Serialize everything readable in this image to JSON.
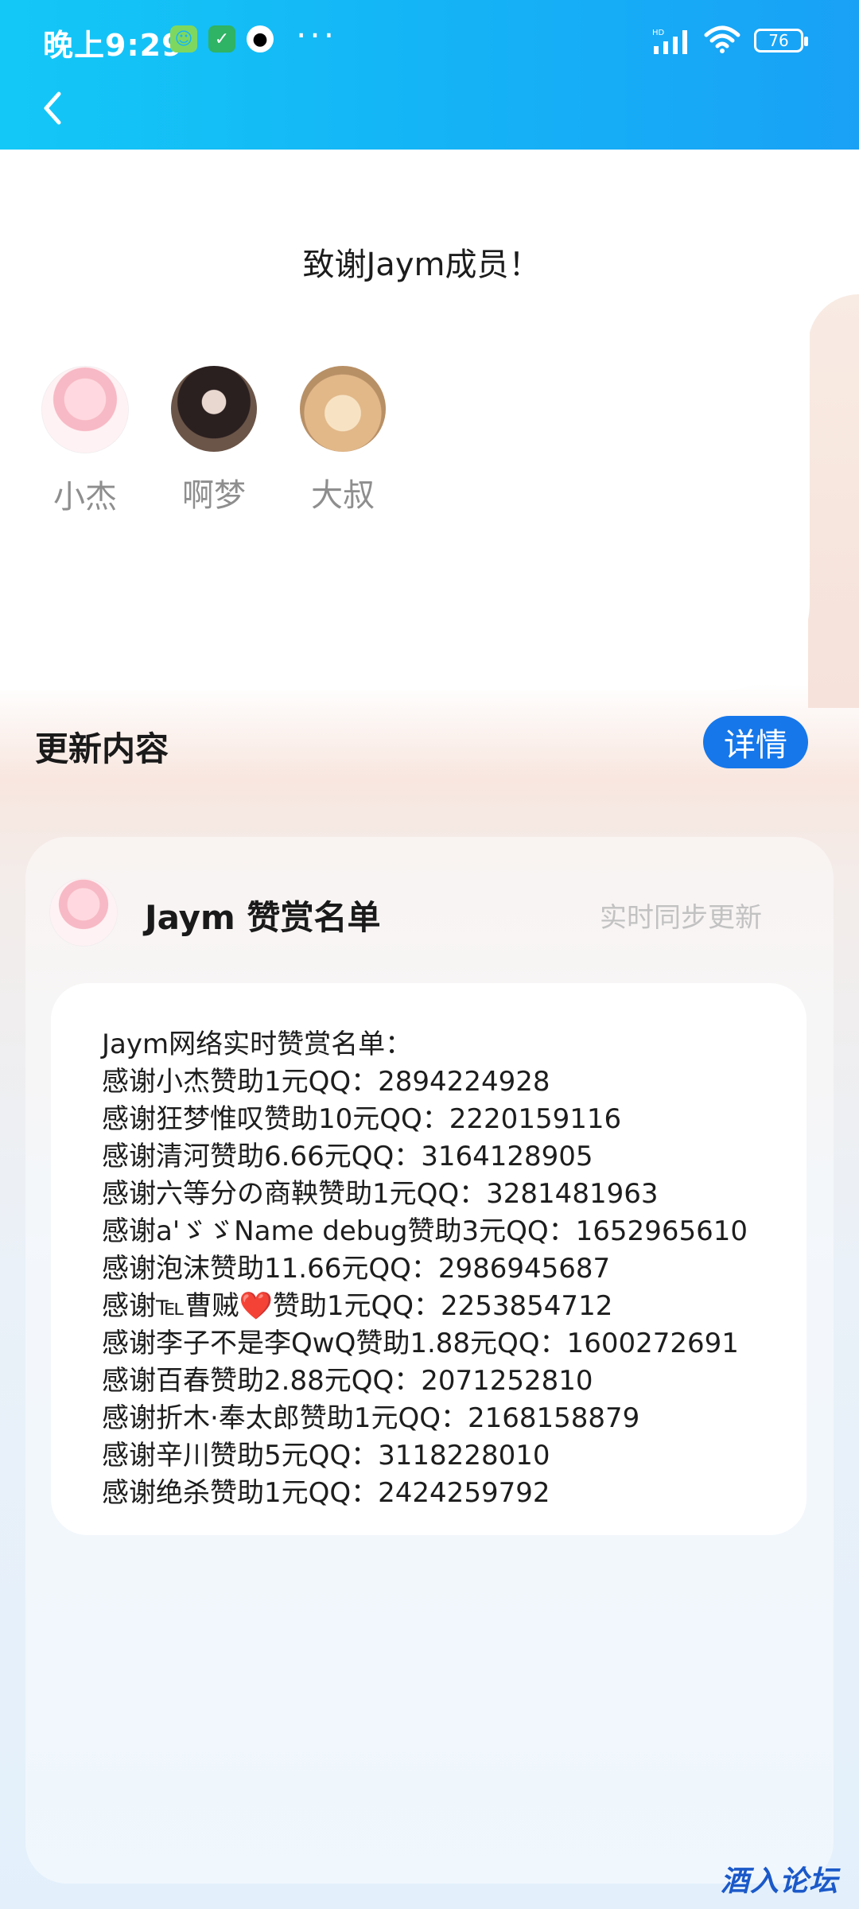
{
  "status_bar": {
    "time": "晚上9:29",
    "dots": "···",
    "battery": "76"
  },
  "thanks": {
    "title": "致谢Jaym成员！",
    "members": [
      {
        "name": "小杰",
        "avatar": "anime-girl-avatar"
      },
      {
        "name": "啊梦",
        "avatar": "person-photo-avatar"
      },
      {
        "name": "大叔",
        "avatar": "cat-photo-avatar"
      }
    ]
  },
  "update": {
    "title": "更新内容",
    "detail_button": "详情"
  },
  "sponsor_card": {
    "title": "Jaym 赞赏名单",
    "subtitle": "实时同步更新",
    "lines": [
      "Jaym网络实时赞赏名单：",
      "感谢小杰赞助1元QQ：2894224928",
      "感谢狂梦惟叹赞助10元QQ：2220159116",
      "感谢清河赞助6.66元QQ：3164128905",
      "感谢六等分の商鞅赞助1元QQ：3281481963",
      "感谢a'ゞゞName debug赞助3元QQ：1652965610",
      "感谢泡沫赞助11.66元QQ：2986945687",
      "感谢℡曹贼❤️赞助1元QQ：2253854712",
      "感谢李子不是李QwQ赞助1.88元QQ：1600272691",
      "感谢百春赞助2.88元QQ：2071252810",
      "感谢折木·奉太郎赞助1元QQ：2168158879",
      "感谢辛川赞助5元QQ：3118228010",
      "感谢绝杀赞助1元QQ：2424259792"
    ]
  },
  "watermark": "酒入论坛",
  "colors": {
    "header_start": "#13c8f7",
    "header_end": "#19a1f6",
    "accent_button": "#1677ea"
  }
}
